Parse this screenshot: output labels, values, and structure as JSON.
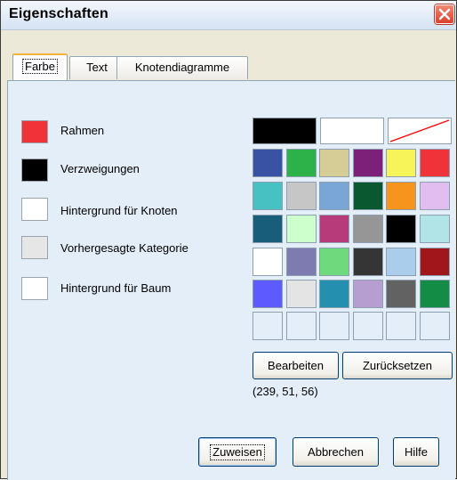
{
  "window": {
    "title": "Eigenschaften"
  },
  "tabs": [
    {
      "label": "Farbe",
      "active": true
    },
    {
      "label": "Text",
      "active": false
    },
    {
      "label": "Knotendiagramme",
      "active": false
    }
  ],
  "legend": [
    {
      "label": "Rahmen",
      "color": "#EF3338"
    },
    {
      "label": "Verzweigungen",
      "color": "#000000"
    },
    {
      "label": "Hintergrund für Knoten",
      "color": "#FFFFFF"
    },
    {
      "label": "Vorhergesagte Kategorie",
      "color": "#E6E6E6"
    },
    {
      "label": "Hintergrund für Baum",
      "color": "#FFFFFF"
    }
  ],
  "palette": {
    "top_row": [
      "#000000",
      "#FFFFFF",
      "none"
    ],
    "rows": [
      [
        "#3A52A4",
        "#2DB24A",
        "#D6CC96",
        "#7D2079",
        "#F7F45A",
        "#EF3338"
      ],
      [
        "#48C1C2",
        "#C6C6C6",
        "#7AA6D6",
        "#0A5830",
        "#F7941D",
        "#E2BDF0"
      ],
      [
        "#185E7A",
        "#CCFFCC",
        "#B73B7A",
        "#969696",
        "#000000",
        "#B0E4E6"
      ],
      [
        "#FFFFFF",
        "#7D7BB0",
        "#6ED97D",
        "#353535",
        "#A9CDEA",
        "#A0161A"
      ],
      [
        "#5D5BFF",
        "#E4E4E4",
        "#248FAE",
        "#B79ED1",
        "#626262",
        "#138C45"
      ],
      [
        "#E4EEF8",
        "#E4EEF8",
        "#E4EEF8",
        "#E4EEF8",
        "#E4EEF8",
        "#E4EEF8"
      ]
    ]
  },
  "buttons": {
    "edit": "Bearbeiten",
    "reset": "Zurücksetzen",
    "apply": "Zuweisen",
    "cancel": "Abbrechen",
    "help": "Hilfe"
  },
  "selected_rgb": "(239, 51, 56)"
}
